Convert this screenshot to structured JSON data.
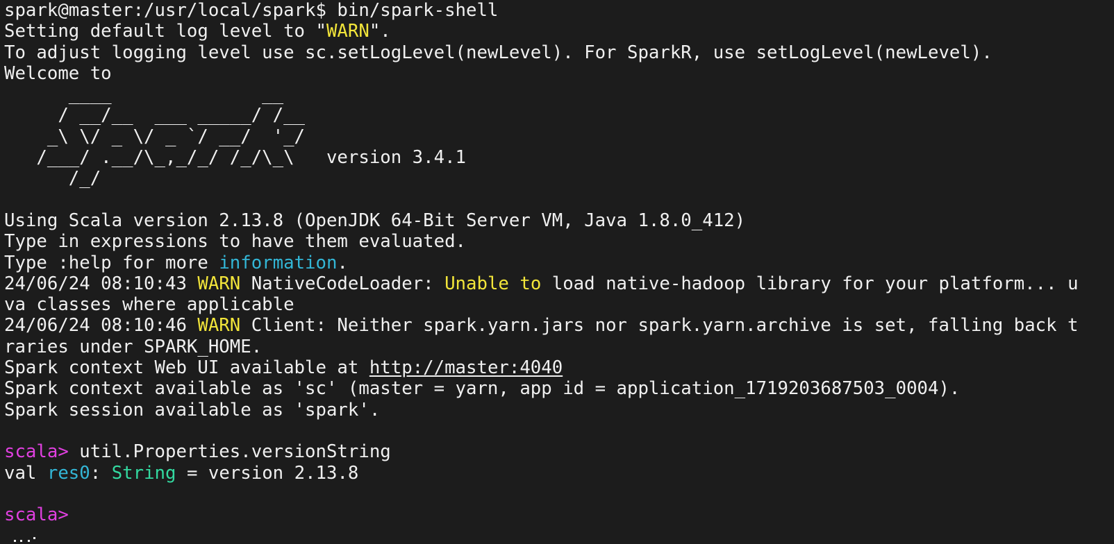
{
  "terminal": {
    "lines": [
      [
        {
          "t": "spark@master:/usr/local/spark$ bin/spark-shell",
          "c": ""
        }
      ],
      [
        {
          "t": "Setting default log level to \"",
          "c": ""
        },
        {
          "t": "WARN",
          "c": "yellow"
        },
        {
          "t": "\".",
          "c": ""
        }
      ],
      [
        {
          "t": "To adjust logging level use sc.setLogLevel(newLevel). For SparkR, use setLogLevel(newLevel).",
          "c": ""
        }
      ],
      [
        {
          "t": "Welcome to",
          "c": ""
        }
      ],
      [
        {
          "t": "      ____              __",
          "c": ""
        }
      ],
      [
        {
          "t": "     / __/__  ___ _____/ /__",
          "c": ""
        }
      ],
      [
        {
          "t": "    _\\ \\/ _ \\/ _ `/ __/  '_/",
          "c": ""
        }
      ],
      [
        {
          "t": "   /___/ .__/\\_,_/_/ /_/\\_\\   version 3.4.1",
          "c": ""
        }
      ],
      [
        {
          "t": "      /_/",
          "c": ""
        }
      ],
      [
        {
          "t": "",
          "c": ""
        }
      ],
      [
        {
          "t": "Using Scala version 2.13.8 (OpenJDK 64-Bit Server VM, Java 1.8.0_412)",
          "c": ""
        }
      ],
      [
        {
          "t": "Type in expressions to have them evaluated.",
          "c": ""
        }
      ],
      [
        {
          "t": "Type :help for more ",
          "c": ""
        },
        {
          "t": "information",
          "c": "cyan"
        },
        {
          "t": ".",
          "c": ""
        }
      ],
      [
        {
          "t": "24/06/24 08:10:43 ",
          "c": ""
        },
        {
          "t": "WARN",
          "c": "yellow"
        },
        {
          "t": " NativeCodeLoader: ",
          "c": ""
        },
        {
          "t": "Unable to",
          "c": "yellow"
        },
        {
          "t": " load native-hadoop library for your platform... u",
          "c": ""
        }
      ],
      [
        {
          "t": "va classes where applicable",
          "c": ""
        }
      ],
      [
        {
          "t": "24/06/24 08:10:46 ",
          "c": ""
        },
        {
          "t": "WARN",
          "c": "yellow"
        },
        {
          "t": " Client: Neither spark.yarn.jars nor spark.yarn.archive is set, falling back t",
          "c": ""
        }
      ],
      [
        {
          "t": "raries under SPARK_HOME.",
          "c": ""
        }
      ],
      [
        {
          "t": "Spark context Web UI available at ",
          "c": ""
        },
        {
          "t": "http://master:4040",
          "c": "link"
        }
      ],
      [
        {
          "t": "Spark context available as 'sc' (master = yarn, app id = application_1719203687503_0004).",
          "c": ""
        }
      ],
      [
        {
          "t": "Spark session available as 'spark'.",
          "c": ""
        }
      ],
      [
        {
          "t": "",
          "c": ""
        }
      ],
      [
        {
          "t": "scala>",
          "c": "magenta"
        },
        {
          "t": " util.Properties.versionString",
          "c": ""
        }
      ],
      [
        {
          "t": "val ",
          "c": ""
        },
        {
          "t": "res0",
          "c": "cyan"
        },
        {
          "t": ": ",
          "c": ""
        },
        {
          "t": "String",
          "c": "green"
        },
        {
          "t": " = version 2.13.8",
          "c": ""
        }
      ],
      [
        {
          "t": "",
          "c": ""
        }
      ],
      [
        {
          "t": "scala>",
          "c": "magenta"
        }
      ]
    ]
  },
  "colors": {
    "background": "#1c1c1c",
    "foreground": "#f0f0f0",
    "yellow": "#f2e53a",
    "cyan": "#33b6d6",
    "magenta": "#e040e0",
    "green": "#33d9a0"
  }
}
